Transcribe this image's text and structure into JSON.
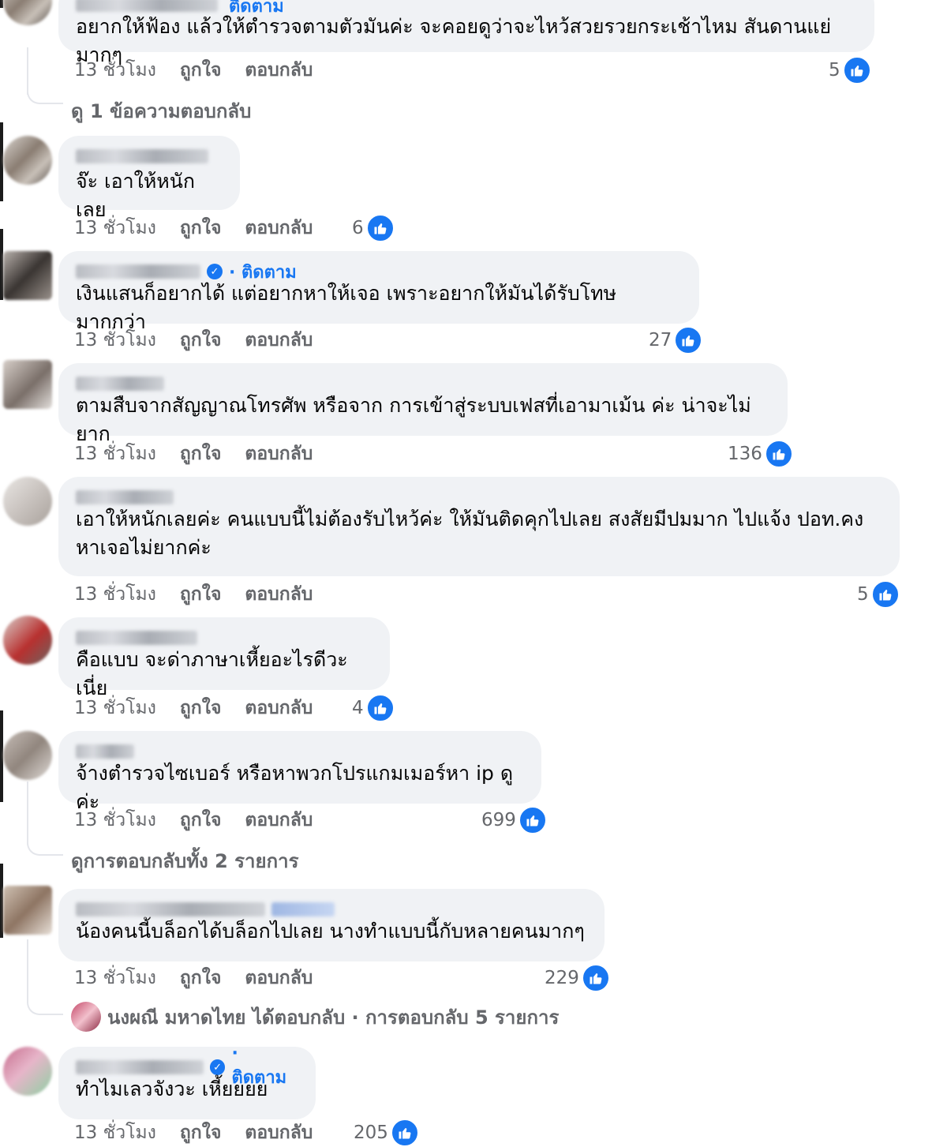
{
  "labels": {
    "time": "13 ชั่วโมง",
    "like": "ถูกใจ",
    "reply": "ตอบกลับ",
    "follow": "· ติดตาม"
  },
  "top_follow": "ติดตาม",
  "comments": [
    {
      "text": "อยากให้ฟ้อง แล้วให้ตำรวจตามตัวมันค่ะ จะคอยดูว่าจะไหว้สวยรวยกระเช้าไหม สันดานแย่มากๆ",
      "likes": "5",
      "thread_link": "ดู 1 ข้อความตอบกลับ"
    },
    {
      "text": "จ๊ะ เอาให้หนักเลย",
      "likes": "6"
    },
    {
      "text": "เงินแสนก็อยากได้ แต่อยากหาให้เจอ เพราะอยากให้มันได้รับโทษมากกว่า",
      "likes": "27",
      "verified": true
    },
    {
      "text": "ตามสืบจากสัญญาณโทรศัพ หรือจาก การเข้าสู่ระบบเฟสที่เอามาเม้น ค่ะ น่าจะไม่ยาก",
      "likes": "136"
    },
    {
      "text": "เอาให้หนักเลยค่ะ คนแบบนี้ไม่ต้องรับไหว้ค่ะ ให้มันติดคุกไปเลย สงสัยมีปมมาก ไปแจ้ง ปอท.คง\nหาเจอไม่ยากค่ะ",
      "likes": "5"
    },
    {
      "text": "คือแบบ จะด่าภาษาเหี้ยอะไรดีวะเนี่ย",
      "likes": "4"
    },
    {
      "text": "จ้างตำรวจไซเบอร์ หรือหาพวกโปรแกมเมอร์หา ip ดูค่ะ",
      "likes": "699",
      "thread_link": "ดูการตอบกลับทั้ง 2 รายการ"
    },
    {
      "text": "น้องคนนี้บล็อกได้บล็อกไปเลย นางทำแบบนี้กับหลายคนมากๆ",
      "likes": "229",
      "thread_link": "นงผณี มหาดไทย ได้ตอบกลับ · การตอบกลับ 5 รายการ"
    },
    {
      "text": "ทำไมเลวจังวะ เหี้ยยยย",
      "likes": "205",
      "verified": true
    }
  ],
  "icons": {
    "like": "thumbs-up-icon",
    "verified": "verified-badge-icon"
  },
  "colors": {
    "bubble": "#f0f2f5",
    "meta_text": "#65676b",
    "accent": "#1877f2"
  }
}
